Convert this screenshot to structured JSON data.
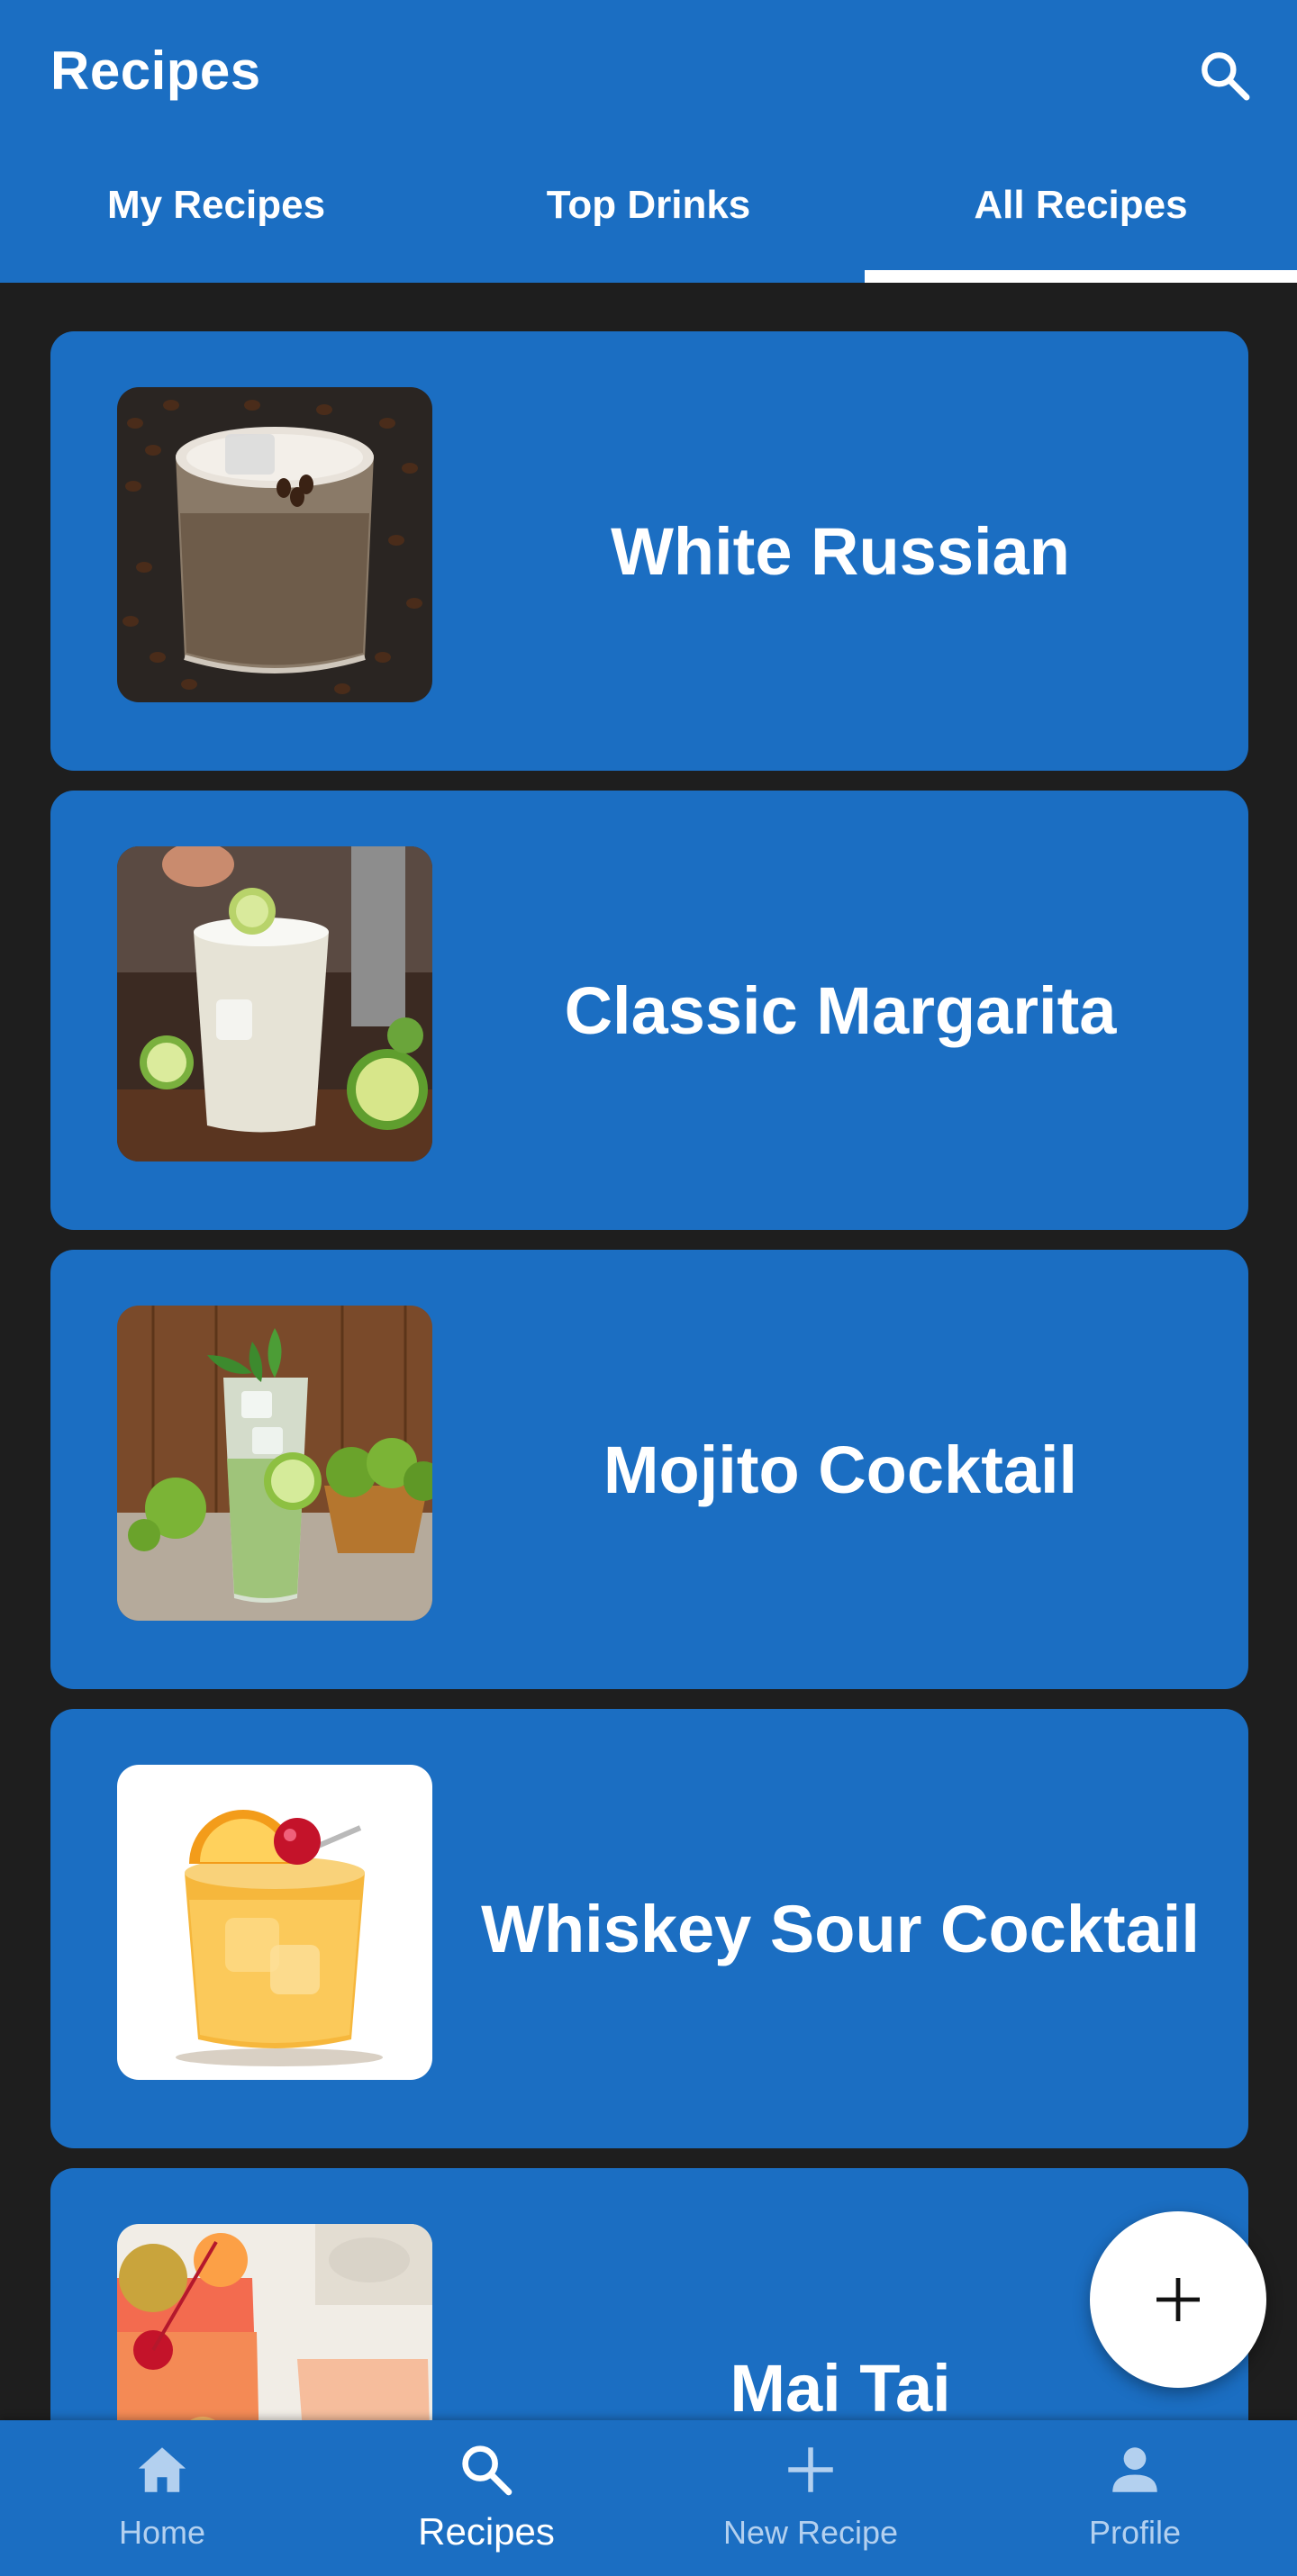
{
  "colors": {
    "primary": "#1b6ec2",
    "background": "#1e1e1e",
    "on_primary": "#ffffff",
    "nav_inactive": "#b3d0ef"
  },
  "appbar": {
    "title": "Recipes",
    "search_icon": "search-icon"
  },
  "tabs": [
    {
      "label": "My Recipes",
      "selected": false
    },
    {
      "label": "Top Drinks",
      "selected": false
    },
    {
      "label": "All Recipes",
      "selected": true
    }
  ],
  "recipes": [
    {
      "title": "White Russian",
      "image": "white-russian-photo"
    },
    {
      "title": "Classic Margarita",
      "image": "margarita-photo"
    },
    {
      "title": "Mojito Cocktail",
      "image": "mojito-photo"
    },
    {
      "title": "Whiskey Sour Cocktail",
      "image": "whiskey-sour-photo"
    },
    {
      "title": "Mai Tai",
      "image": "mai-tai-photo"
    }
  ],
  "fab": {
    "icon": "plus-icon"
  },
  "bottom_nav": [
    {
      "label": "Home",
      "icon": "home-icon",
      "active": false
    },
    {
      "label": "Recipes",
      "icon": "search-icon",
      "active": true
    },
    {
      "label": "New Recipe",
      "icon": "plus-icon",
      "active": false
    },
    {
      "label": "Profile",
      "icon": "person-icon",
      "active": false
    }
  ]
}
